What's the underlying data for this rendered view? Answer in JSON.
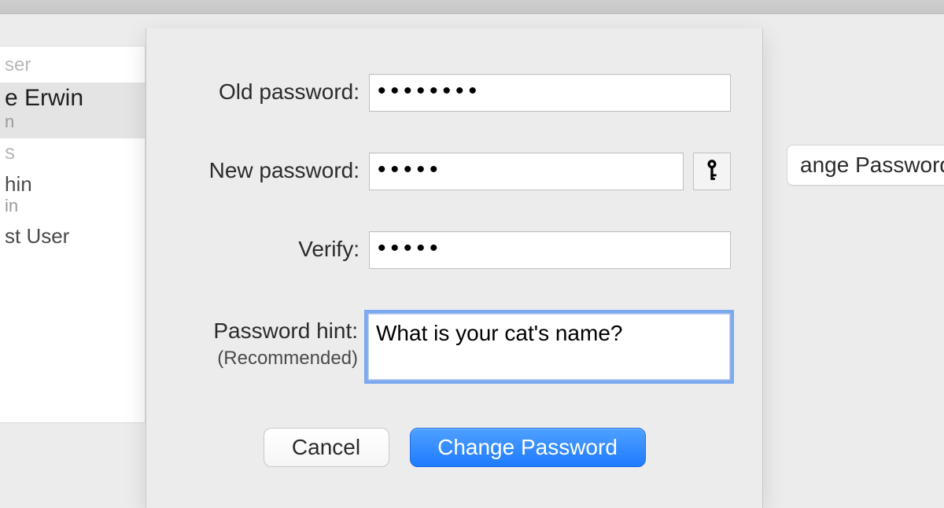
{
  "sidebar": {
    "group_label": "ser",
    "items": [
      {
        "name": "e Erwin",
        "sub": "n",
        "selected": true
      },
      {
        "name": "s",
        "sub": "",
        "selected": false,
        "disabled": true
      },
      {
        "name": "hin",
        "sub": "in",
        "selected": false
      },
      {
        "name": "st User",
        "sub": "",
        "selected": false
      }
    ]
  },
  "background_button_label": "ange Password",
  "form": {
    "old_password": {
      "label": "Old password:",
      "value": "••••••••"
    },
    "new_password": {
      "label": "New password:",
      "value": "•••••"
    },
    "verify": {
      "label": "Verify:",
      "value": "•••••"
    },
    "hint": {
      "label": "Password hint:",
      "subnote": "(Recommended)",
      "value": "What is your cat's name?"
    }
  },
  "buttons": {
    "cancel": "Cancel",
    "confirm": "Change Password"
  },
  "icons": {
    "key": "key-icon"
  }
}
